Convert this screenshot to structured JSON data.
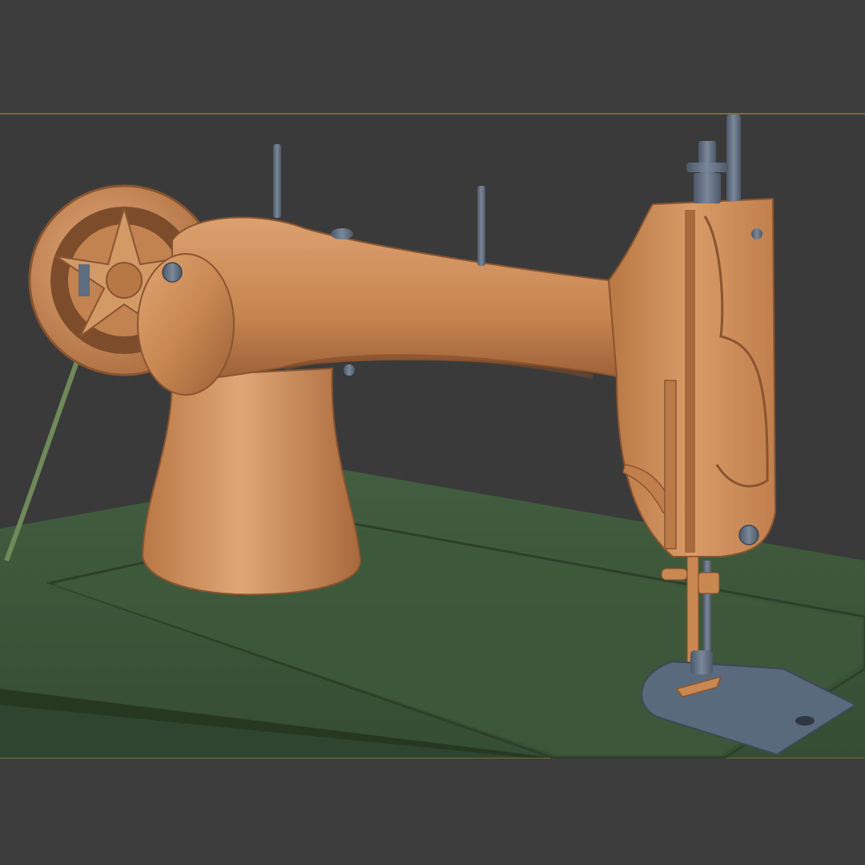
{
  "scene": {
    "subject": "sewing-machine-3d-render",
    "colors": {
      "background": "#3d3d3d",
      "viewport": "#3a3a3a",
      "safe_frame_line": "#8f7a3a",
      "machine_body": "#cf8f5a",
      "machine_shadow": "#8a5430",
      "table_top": "#3f5a3c",
      "table_edge": "#2c4029",
      "metal_parts": "#5f6d80",
      "belt": "#6f8a5a"
    },
    "icons": [
      "hand-wheel-icon",
      "spool-pin-icon",
      "presser-foot-icon",
      "needle-plate-icon"
    ]
  }
}
